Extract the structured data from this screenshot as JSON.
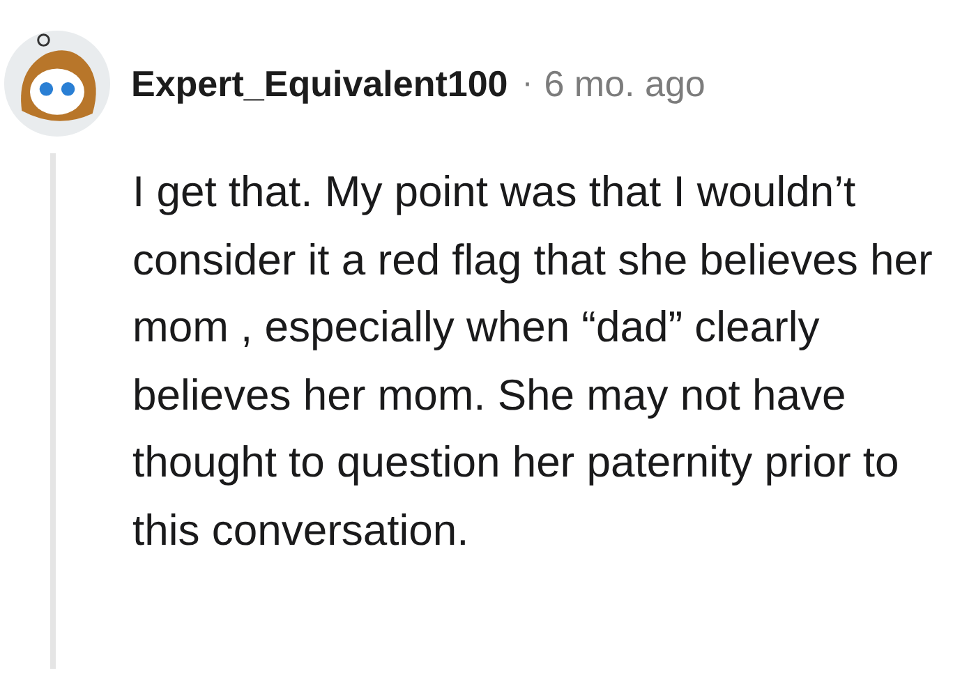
{
  "comment": {
    "author": "Expert_Equivalent100",
    "separator": "·",
    "time": "6 mo. ago",
    "body": "I get that. My point was that I wouldn’t consider it a red flag that she believes her mom , especially when “dad” clearly believes her mom. She may not have thought to question her paternity prior to this conversation."
  }
}
